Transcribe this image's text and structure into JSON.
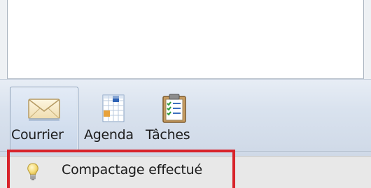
{
  "navigation": {
    "buttons": [
      {
        "label": "Courrier",
        "icon": "mail-icon",
        "selected": true
      },
      {
        "label": "Agenda",
        "icon": "calendar-icon",
        "selected": false
      },
      {
        "label": "Tâches",
        "icon": "tasks-icon",
        "selected": false
      }
    ]
  },
  "status_bar": {
    "message": "Compactage effectué",
    "icon": "lightbulb-icon"
  },
  "colors": {
    "highlight_border": "#d8232a",
    "nav_background": "#d9e2ee",
    "selected_button_border": "#7e95b2"
  }
}
